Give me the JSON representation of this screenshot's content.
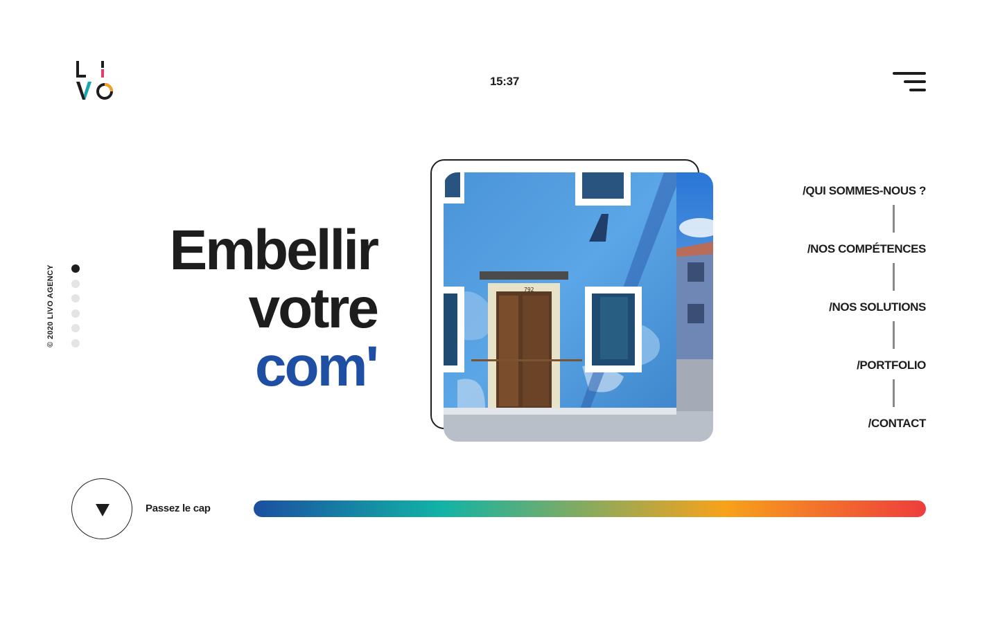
{
  "brand": {
    "logo_letters": [
      "L",
      "I",
      "V",
      "O"
    ],
    "logo_accents": {
      "i_color": "#e73b6f",
      "v_color": "#17a8b5",
      "o_color": "#f5a01f"
    }
  },
  "header": {
    "time": "15:37",
    "menu_icon": "hamburger-menu-icon"
  },
  "sidebar": {
    "copyright": "© 2020 LIVO AGENCY",
    "slides": 6,
    "active_slide": 1
  },
  "hero": {
    "line1": "Embellir",
    "line2": "votre",
    "line3": "com'",
    "accent_color": "#1f4ea5"
  },
  "nav": {
    "items": [
      {
        "label": "/QUI SOMMES-NOUS ?"
      },
      {
        "label": "/NOS COMPÉTENCES"
      },
      {
        "label": "/NOS SOLUTIONS"
      },
      {
        "label": "/PORTFOLIO"
      },
      {
        "label": "/CONTACT"
      }
    ]
  },
  "footer": {
    "scroll_icon": "triangle-down-icon",
    "scroll_label": "Passez le cap",
    "gradient_colors": [
      "#1b4fa1",
      "#12b3a6",
      "#f7a21b",
      "#ee3d3d"
    ]
  },
  "photo": {
    "house_number": "792"
  }
}
